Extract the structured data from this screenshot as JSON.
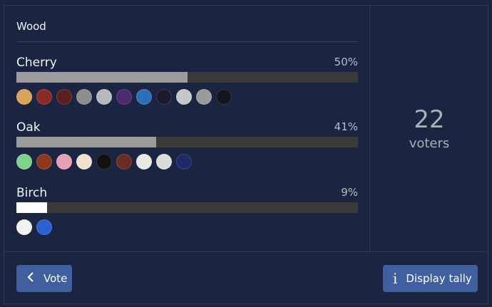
{
  "poll": {
    "title": "Wood",
    "options": [
      {
        "label": "Cherry",
        "percent_text": "50%",
        "percent": 50,
        "bar_color": "#9c9c9c",
        "avatar_colors": [
          "#d8a45a",
          "#8a2a26",
          "#5a2020",
          "#8d8d8d",
          "#b9b9b9",
          "#4b2a6e",
          "#2d6fb6",
          "#1a1a2a",
          "#c7c7c7",
          "#9a9a9a",
          "#151520"
        ]
      },
      {
        "label": "Oak",
        "percent_text": "41%",
        "percent": 41,
        "bar_color": "#9c9c9c",
        "avatar_colors": [
          "#7fd08a",
          "#8c3a1e",
          "#e6a0b8",
          "#f0e0d0",
          "#111111",
          "#6a2d20",
          "#e8e8e8",
          "#dcdcdc",
          "#1e2a6a"
        ]
      },
      {
        "label": "Birch",
        "percent_text": "9%",
        "percent": 9,
        "bar_color": "#ffffff",
        "avatar_colors": [
          "#f2f2f2",
          "#2c5fd0"
        ]
      }
    ]
  },
  "summary": {
    "count": "22",
    "label": "voters"
  },
  "actions": {
    "vote_label": "Vote",
    "vote_icon": "chevron-left-icon",
    "tally_label": "Display tally",
    "tally_icon": "info-icon"
  }
}
